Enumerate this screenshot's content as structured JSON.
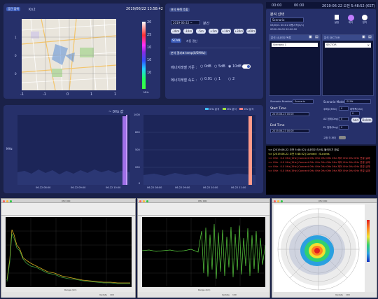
{
  "map_panel": {
    "tab_label": "공간 검색",
    "subtab_label": "Kn2",
    "datetime": "2019/06/22 13:58:42",
    "x_ticks": [
      "-1",
      "-1",
      "0",
      "1",
      "1"
    ],
    "y_ticks": [
      "1",
      "0",
      "0"
    ],
    "colorbar_ticks": [
      "20",
      "25",
      "10",
      "10",
      "10",
      "10"
    ],
    "colorbar_unit": "MHz"
  },
  "control_panel": {
    "title": "표식 위해 추출",
    "time_field": "2019-06-22 ~",
    "time_unit": "분간",
    "time_buttons": [
      "-30m",
      "-10m",
      "-5m",
      "+5m",
      "+10m",
      "+30m",
      "+60m"
    ],
    "toggle_label": "SCAN",
    "toggle_sub": "자동 갱신",
    "section2_title": "분석 결과표 temp(0/5MHz)",
    "row1_label": "에너지레벨 기준 :",
    "row1_options": [
      "0dB",
      "5dB",
      "10dB"
    ],
    "row2_label": "에너지레벨 속도 :",
    "row2_options": [
      "0.01",
      "1",
      "2"
    ]
  },
  "spectrum_panel": {
    "left_title": "~ 0Hz 값",
    "left_ylabel": "MHz",
    "left_xticks": [
      "06-22 08:00",
      "06-22 09:00",
      "06-22 10:00"
    ],
    "left_yticks": [
      "10",
      "9",
      "8",
      "7",
      "6"
    ],
    "right_legend": [
      "0Hz 분석",
      "0Hz 분석",
      "0Hz 분석"
    ],
    "right_yticks": [
      "1000",
      "800",
      "500",
      "200",
      "0"
    ],
    "right_xticks": [
      "06-22 08:00",
      "06-22 09:00",
      "06-22 10:00",
      "06-22 11:00"
    ]
  },
  "right_panel": {
    "status_time": "2019-06-22 오전 5:48:52 (KST)",
    "status_left": "00:00",
    "status_mid": "00:00",
    "title": "분석 선택",
    "scenario_field": "Scenario",
    "info_line1": "03/0/01 00:01 비행시작(0/1)",
    "info_line2": "0000-00-00 00:00:00",
    "toolbar_buttons": [
      "설정",
      "제어",
      "정지"
    ],
    "scenario_list_header": "분석 시나리오 목록",
    "scenario_item": "Scenario 1",
    "sector_header": "분석 SECTOR",
    "sector_item": "SECTOR",
    "scenario_number_label": "Scenario Number",
    "scenario_number_value": "Scenario",
    "scenario_mode_label": "Scenario Mode",
    "scenario_mode_value": "SCAN",
    "start_time_label": "Start Time",
    "start_time_value": "2019-06-23 00:00",
    "end_time_label": "End Time",
    "end_time_value": "2019-06-23 00:00",
    "fields": [
      {
        "label": "주파수(MHz)",
        "value": "0"
      },
      {
        "label": "대역폭(kHz)",
        "value": "0"
      },
      {
        "label": "AZ 범위(Deg)",
        "value": "0"
      },
      {
        "label": "EL 범위(Deg)",
        "value": "0"
      }
    ],
    "add_label": "Add",
    "delete_label": "Delete",
    "rotator_label": "고정 각 제어"
  },
  "log": [
    {
      "text": "<> [2019-06-22 오전 5:48:52] 시나리오 리스트 불러오기 완료",
      "color": "#ffffff"
    },
    {
      "text": "<> [2019-06-22 오전 5:48:52] Connect : Success",
      "color": "#ffff66"
    },
    {
      "text": "<> 0Hz : 0.0 0Hz [0Hz] Connect 0Hz 0Hz 0Hz 0Hz 0Hz 제어 0Hz 0Hz 0Hz 연결 실패",
      "color": "#ff4a4a"
    },
    {
      "text": "<> 0Hz : 0.0 0Hz [0Hz] Connect 0Hz 0Hz 0Hz 0Hz 0Hz 제어 0Hz 0Hz 0Hz 연결 실패",
      "color": "#ff4a4a"
    },
    {
      "text": "<> 0Hz : 0.0 0Hz [0Hz] Connect 0Hz 0Hz 0Hz 0Hz 0Hz 제어 0Hz 0Hz 0Hz 연결 실패",
      "color": "#ff4a4a"
    },
    {
      "text": "<> 0Hz : 0.0 0Hz [0Hz] Connect 0Hz 0Hz 0Hz 0Hz 0Hz 제어 0Hz 0Hz 0Hz 연결 실패",
      "color": "#ff4a4a"
    }
  ],
  "windows": [
    {
      "title": "0Hz 000",
      "footer_label": "Update",
      "footer_value": "100",
      "xlabel": "Range (km)"
    },
    {
      "title": "0Hz 000",
      "footer_label": "Update",
      "footer_value": "100",
      "xlabel": "Range (km)"
    },
    {
      "title": "0Hz 000",
      "footer_label": "Update",
      "footer_value": "100",
      "xlabel": ""
    }
  ],
  "colors": {
    "bg": "#1a2148",
    "panel": "#26306a",
    "accent": "#3a5ab8",
    "log_bg": "#000000"
  }
}
